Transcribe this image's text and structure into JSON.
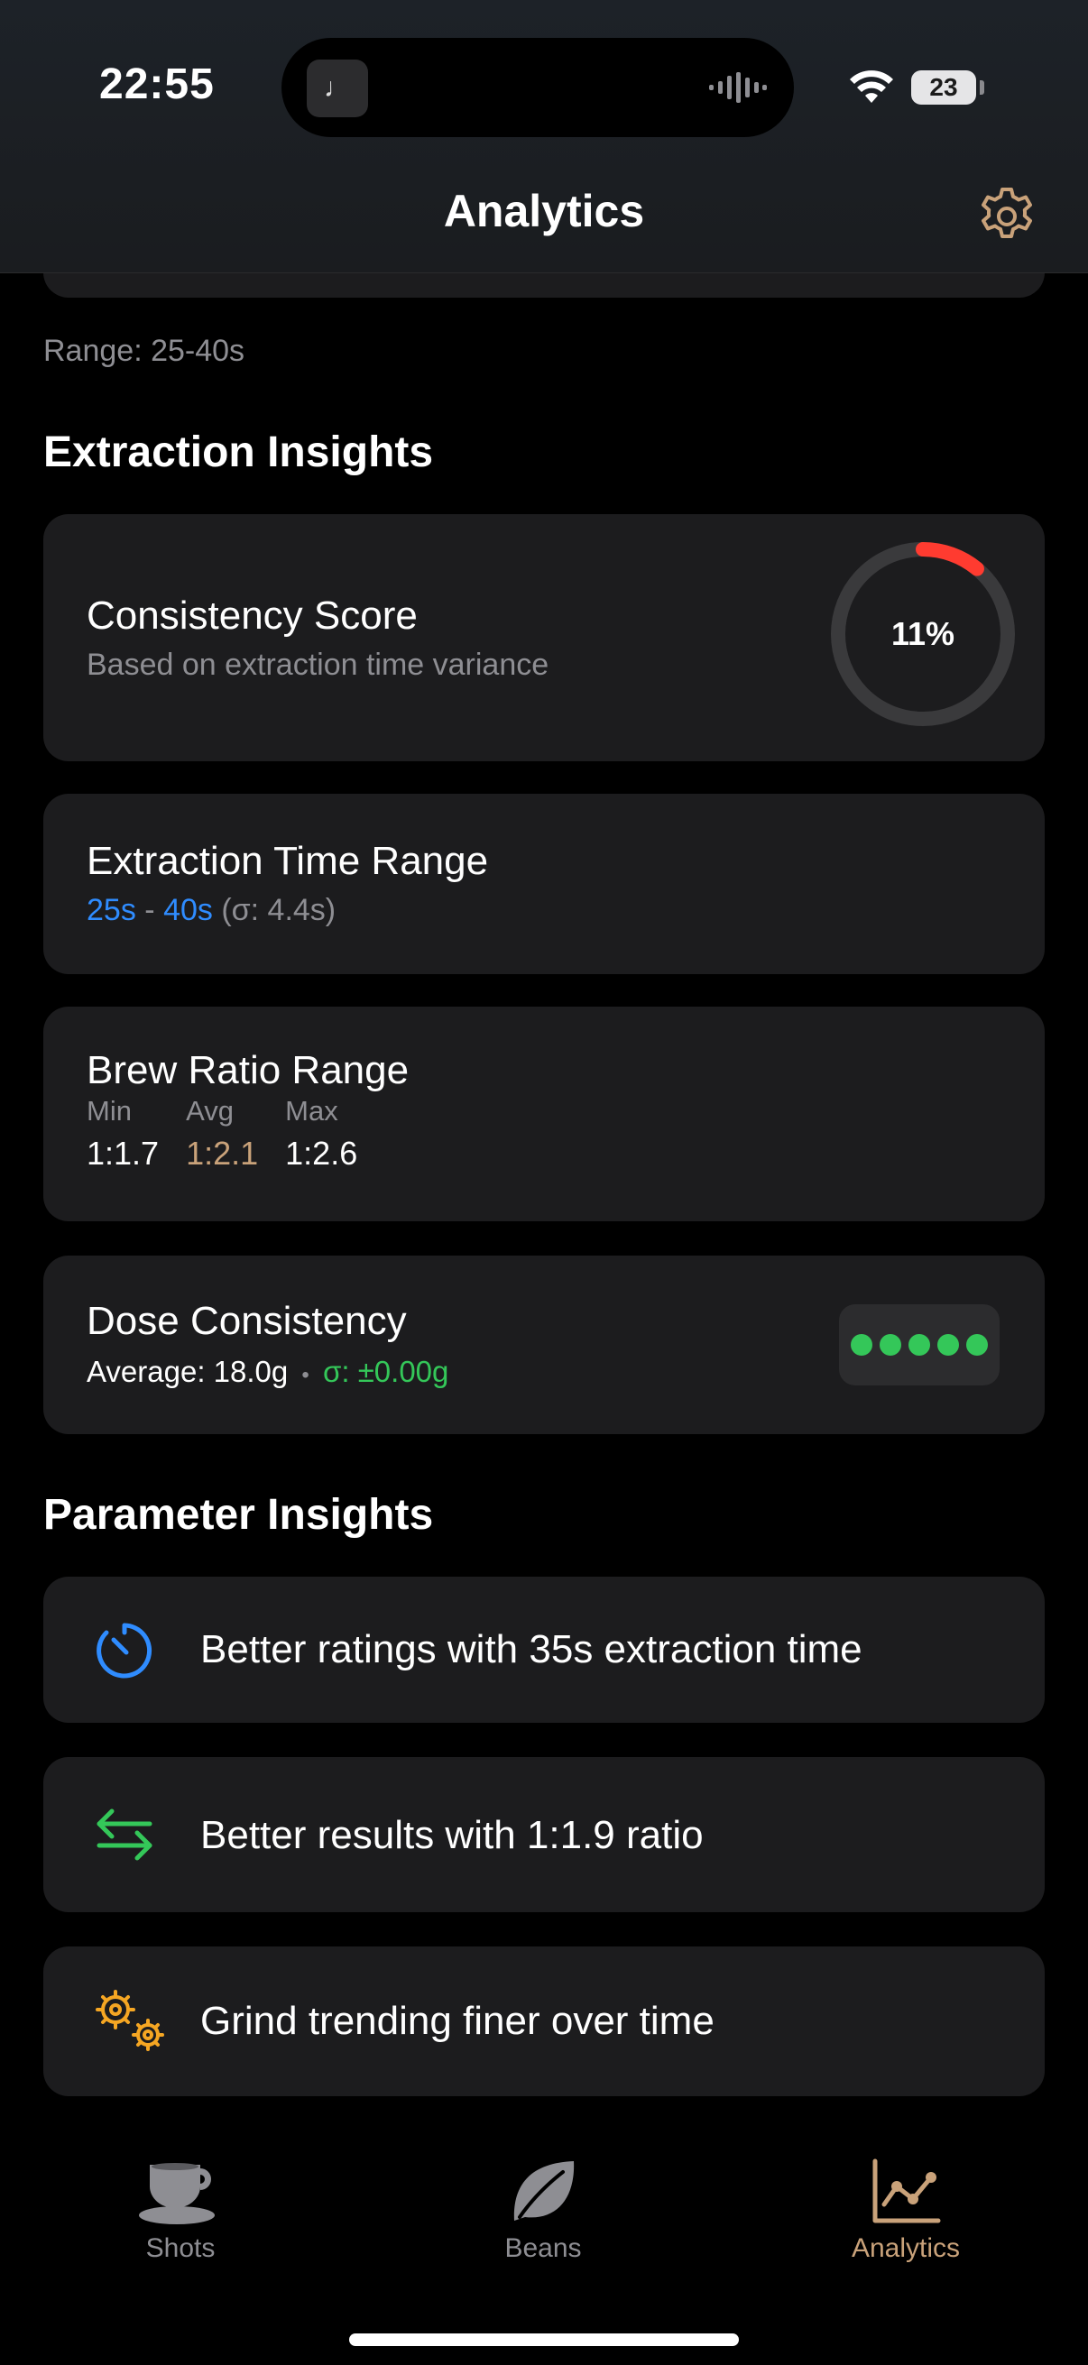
{
  "status": {
    "time": "22:55",
    "battery": "23"
  },
  "nav": {
    "title": "Analytics"
  },
  "timing": {
    "range_text": "Range: 25-40s"
  },
  "extraction": {
    "section_title": "Extraction Insights",
    "consistency": {
      "title": "Consistency Score",
      "subtitle": "Based on extraction time variance",
      "percent_label": "11%",
      "percent_value": 0.11
    },
    "time_range": {
      "title": "Extraction Time Range",
      "min": "25s",
      "sep": "-",
      "max": "40s",
      "sigma": "(σ: 4.4s)"
    },
    "brew_ratio": {
      "title": "Brew Ratio Range",
      "min_label": "Min",
      "min_value": "1:1.7",
      "avg_label": "Avg",
      "avg_value": "1:2.1",
      "max_label": "Max",
      "max_value": "1:2.6"
    },
    "dose": {
      "title": "Dose Consistency",
      "average": "Average: 18.0g",
      "bullet": "•",
      "sigma": "σ: ±0.00g",
      "dots_filled": 5
    }
  },
  "parameters": {
    "section_title": "Parameter Insights",
    "items": [
      {
        "icon": "timer-icon",
        "text": "Better ratings with 35s extraction time",
        "color": "#2f8cff"
      },
      {
        "icon": "arrows-exchange-icon",
        "text": "Better results with 1:1.9 ratio",
        "color": "#34c759"
      },
      {
        "icon": "gears-icon",
        "text": "Grind trending finer over time",
        "color": "#f5a623"
      }
    ]
  },
  "tabs": [
    {
      "label": "Shots",
      "icon": "coffee-cup-icon",
      "active": false
    },
    {
      "label": "Beans",
      "icon": "leaf-icon",
      "active": false
    },
    {
      "label": "Analytics",
      "icon": "chart-icon",
      "active": true
    }
  ],
  "colors": {
    "accent": "#c9a27a",
    "blue": "#2f8cff",
    "green": "#34c759",
    "red": "#ff3b30",
    "card": "#1c1c1e"
  }
}
